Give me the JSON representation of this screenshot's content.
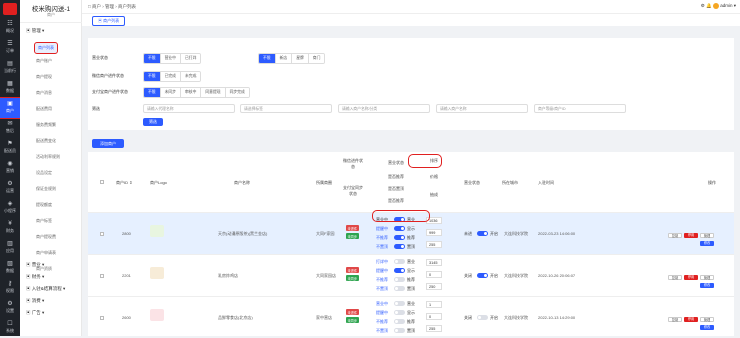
{
  "app": {
    "name": "校米购闪送-1",
    "sub": "商户"
  },
  "rail": [
    {
      "label": "概况",
      "icon": "☷"
    },
    {
      "label": "订单",
      "icon": "☰"
    },
    {
      "label": "当前行",
      "icon": "▤"
    },
    {
      "label": "数据",
      "icon": "▦"
    },
    {
      "label": "商户",
      "icon": "▣"
    },
    {
      "label": "售后",
      "icon": "✉"
    },
    {
      "label": "配送员",
      "icon": "⚑"
    },
    {
      "label": "营销",
      "icon": "◉"
    },
    {
      "label": "运营",
      "icon": "⚙"
    },
    {
      "label": "小程序",
      "icon": "◈"
    },
    {
      "label": "财务",
      "icon": "¥"
    },
    {
      "label": "应用",
      "icon": "▥"
    },
    {
      "label": "数据",
      "icon": "▧"
    },
    {
      "label": "权限",
      "icon": "⚷"
    },
    {
      "label": "设置",
      "icon": "⚙"
    },
    {
      "label": "系统",
      "icon": "☐"
    }
  ],
  "subnav": {
    "group": "管理",
    "items": [
      "商户列表",
      "商户账户",
      "商户提现",
      "商户消息",
      "配送费用",
      "服务费频繁",
      "配送费变化",
      "活动利率规则",
      "设品设定",
      "保证金规则",
      "提现额度",
      "商户标签",
      "商户提现费",
      "商户申请表",
      "商户资质"
    ],
    "groups2": [
      "营业",
      "财务",
      "入驻&结算流程",
      "消费",
      "广告"
    ]
  },
  "topbar": {
    "breadcrumb": "□  商户  ›  管理  ›  商户列表",
    "user": "admin ▾"
  },
  "tab": "商户列表",
  "filters": {
    "r1": {
      "label": "营业状态",
      "opts": [
        "不限",
        "营业中",
        "已打烊"
      ]
    },
    "r1b": {
      "opts": [
        "不限",
        "新店",
        "星牌",
        "商门"
      ]
    },
    "r2": {
      "label": "微信商户进件状态",
      "opts": [
        "不限",
        "已完成",
        "未完成"
      ]
    },
    "r3": {
      "label": "支付宝商户进件状态",
      "opts": [
        "不限",
        "未同步",
        "审核中",
        "同意提现",
        "同步完成"
      ]
    },
    "r4": {
      "label": "筛选",
      "p1": "请输入代理名称",
      "p2": "请选择标签",
      "p3": "请输入商户名称/分类",
      "p4": "请输入商户名称",
      "p5": "商户等级/商户ID"
    },
    "search": "筛选"
  },
  "add_btn": "添加商户",
  "table": {
    "headers": {
      "id": "商户ID ⇕",
      "logo": "商户Logo",
      "name": "商户名称",
      "cat": "所属商圈",
      "wx": "微信进件状态",
      "ali": "支付宝同步状态",
      "status": "营业状态",
      "sort": "排序",
      "sub1": "营业状态",
      "sub2": "是否推荐",
      "sub3": "是否置顶",
      "sub4": "是否推荐",
      "biz": "营业状态",
      "city": "所在城市",
      "time": "入驻时间",
      "op": "操作",
      "price": "价格",
      "cap": "抽成"
    },
    "rows": [
      {
        "id": "2800",
        "name": "天京(动漫原版茶)(黑兰金店)",
        "cat": "大同F家园",
        "wx": "未进件",
        "ali": "未同步",
        "sw": [
          [
            "营业中",
            "营业"
          ],
          [
            "提醒中",
            "显示"
          ],
          [
            "不推荐",
            "推荐"
          ],
          [
            "不置顶",
            "置顶"
          ]
        ],
        "sw_on": [
          true,
          true,
          true,
          true
        ],
        "nums": [
          "1036",
          "999",
          "255"
        ],
        "biz": "未进",
        "biz2": "开启",
        "city": "大连科技学院",
        "time": "2022-03-23 14:06:00",
        "ops": [
          "复制",
          "停用",
          "管理",
          "修改"
        ]
      },
      {
        "id": "2201",
        "name": "乳房炸鸡店",
        "cat": "大同家园店",
        "wx": "未进件",
        "ali": "未同步",
        "sw": [
          [
            "打烊中",
            "营业"
          ],
          [
            "提醒中",
            "显示"
          ],
          [
            "不推荐",
            "推荐"
          ],
          [
            "不置顶",
            "置顶"
          ]
        ],
        "sw_on": [
          false,
          true,
          false,
          false
        ],
        "nums": [
          "3145",
          "0",
          "250"
        ],
        "biz": "关闭",
        "biz2": "开启",
        "city": "大连科技学院",
        "time": "2022-10-26 20:06:07",
        "ops": [
          "复制",
          "停用",
          "管理",
          "修改"
        ]
      },
      {
        "id": "2600",
        "name": "品鲜零食店(北京店)",
        "cat": "家中营店",
        "wx": "未进件",
        "ali": "未同步",
        "sw": [
          [
            "营业中",
            "营业"
          ],
          [
            "提醒中",
            "显示"
          ],
          [
            "不推荐",
            "推荐"
          ],
          [
            "不置顶",
            "置顶"
          ]
        ],
        "sw_on": [
          false,
          false,
          false,
          false
        ],
        "nums": [
          "1",
          "0",
          "255"
        ],
        "biz": "关闭",
        "biz2": "开启",
        "city": "大连科技学院",
        "time": "2022-10-13 14:29:00",
        "ops": [
          "复制",
          "停用",
          "管理",
          "修改"
        ]
      }
    ]
  }
}
